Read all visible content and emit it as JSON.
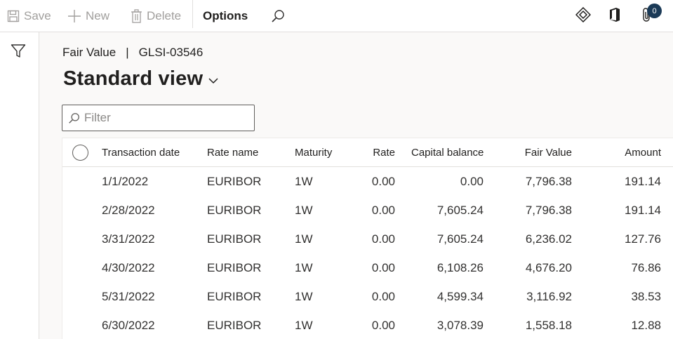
{
  "toolbar": {
    "save_label": "Save",
    "new_label": "New",
    "delete_label": "Delete",
    "options_label": "Options",
    "notification_count": "0",
    "icons": [
      "save-icon",
      "plus-icon",
      "trash-icon",
      "search-icon",
      "diamond-icon",
      "office-icon",
      "attach-icon"
    ]
  },
  "breadcrumb": {
    "module": "Fair Value",
    "separator": "|",
    "record": "GLSI-03546"
  },
  "view": {
    "title": "Standard view"
  },
  "filter": {
    "placeholder": "Filter"
  },
  "grid": {
    "columns": [
      "Transaction date",
      "Rate name",
      "Maturity",
      "Rate",
      "Capital balance",
      "Fair Value",
      "Amount"
    ],
    "rows": [
      {
        "date": "1/1/2022",
        "rate_name": "EURIBOR",
        "maturity": "1W",
        "rate": "0.00",
        "capital": "0.00",
        "fair": "7,796.38",
        "amount": "191.14"
      },
      {
        "date": "2/28/2022",
        "rate_name": "EURIBOR",
        "maturity": "1W",
        "rate": "0.00",
        "capital": "7,605.24",
        "fair": "7,796.38",
        "amount": "191.14"
      },
      {
        "date": "3/31/2022",
        "rate_name": "EURIBOR",
        "maturity": "1W",
        "rate": "0.00",
        "capital": "7,605.24",
        "fair": "6,236.02",
        "amount": "127.76"
      },
      {
        "date": "4/30/2022",
        "rate_name": "EURIBOR",
        "maturity": "1W",
        "rate": "0.00",
        "capital": "6,108.26",
        "fair": "4,676.20",
        "amount": "76.86"
      },
      {
        "date": "5/31/2022",
        "rate_name": "EURIBOR",
        "maturity": "1W",
        "rate": "0.00",
        "capital": "4,599.34",
        "fair": "3,116.92",
        "amount": "38.53"
      },
      {
        "date": "6/30/2022",
        "rate_name": "EURIBOR",
        "maturity": "1W",
        "rate": "0.00",
        "capital": "3,078.39",
        "fair": "1,558.18",
        "amount": "12.88"
      }
    ]
  },
  "colors": {
    "disabled_text": "#a19f9d",
    "badge": "#1b3a57",
    "content_bg": "#faf9f8"
  }
}
